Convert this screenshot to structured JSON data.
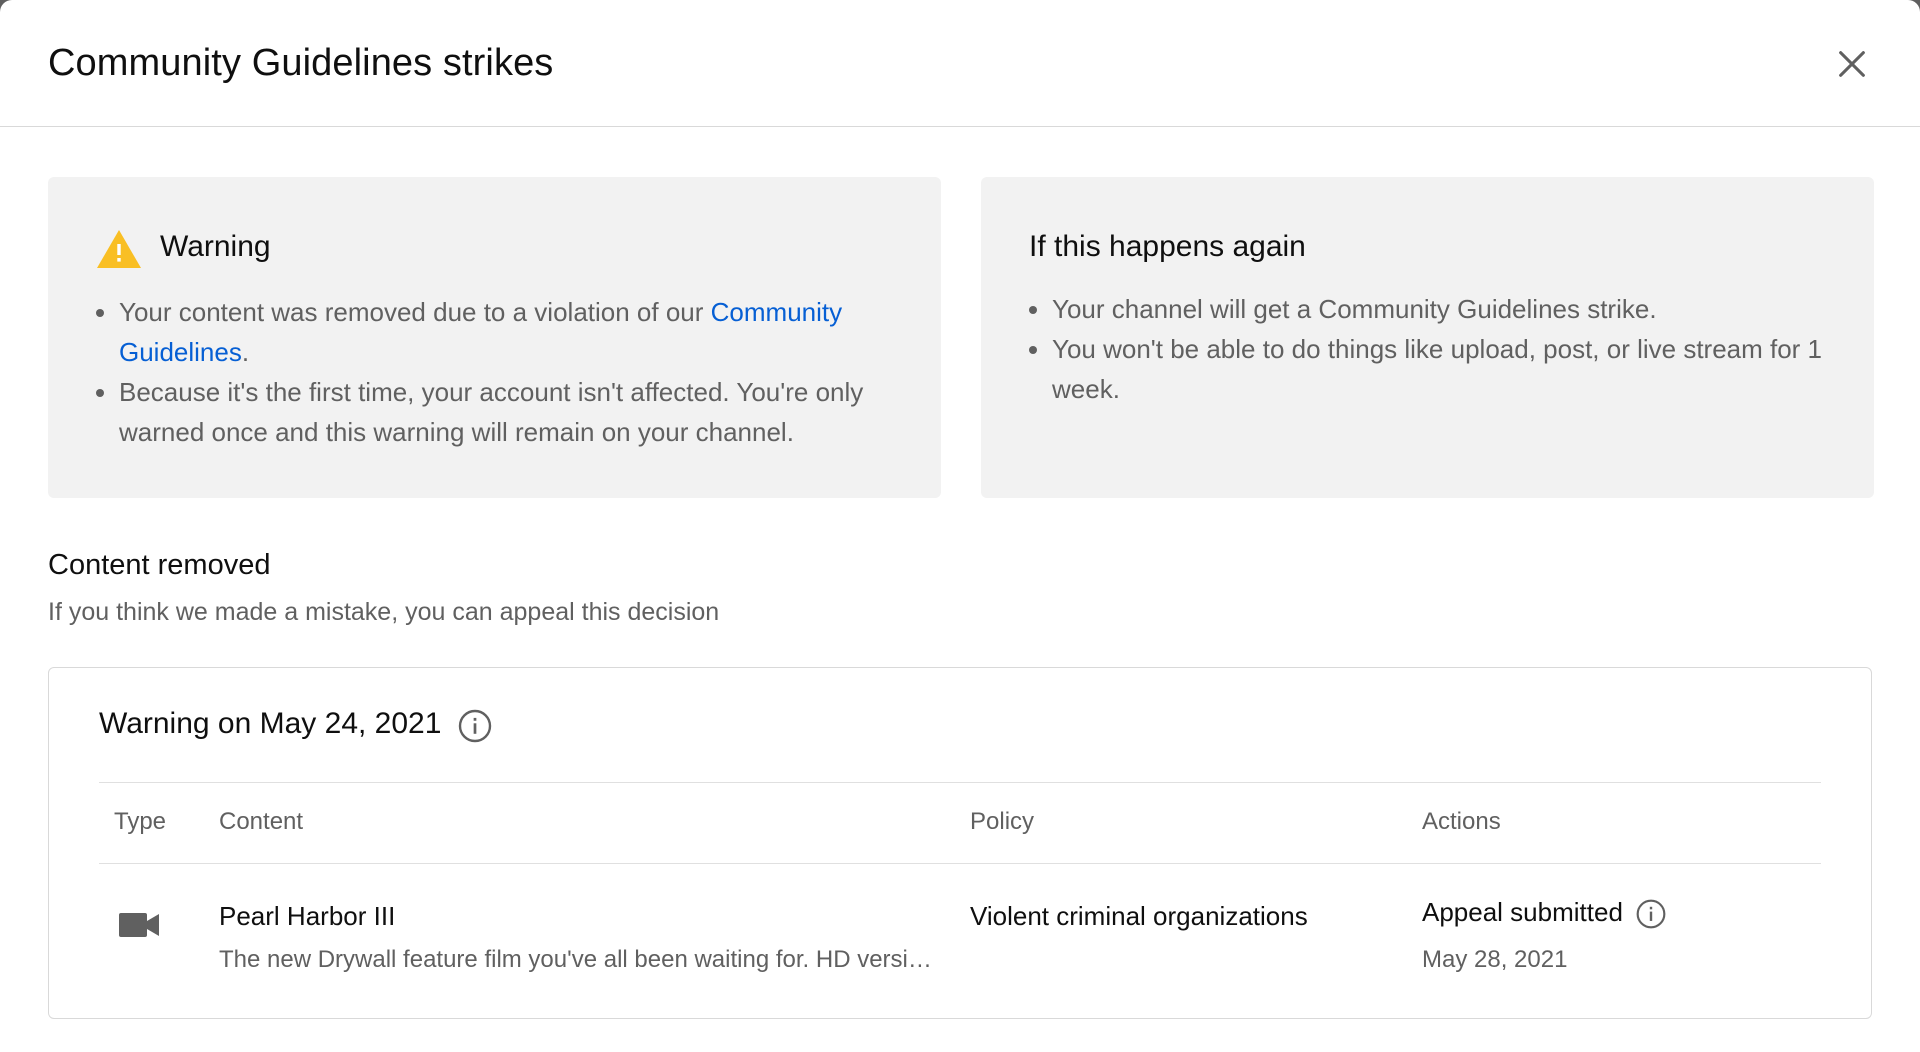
{
  "dialog": {
    "title": "Community Guidelines strikes",
    "close_icon": "close-icon"
  },
  "warning_card": {
    "heading": "Warning",
    "icon": "warning-triangle-icon",
    "icon_color": "#f9bf24",
    "bullet1_prefix": "Your content was removed due to a violation of our",
    "bullet1_link": "Community Guidelines",
    "bullet1_suffix": ".",
    "bullet2": "Because it's the first time, your account isn't affected. You're only warned once and this warning will remain on your channel."
  },
  "again_card": {
    "heading": "If this happens again",
    "bullet1": "Your channel will get a Community Guidelines strike.",
    "bullet2": "You won't be able to do things like upload, post, or live stream for 1 week."
  },
  "content_removed": {
    "title": "Content removed",
    "subtitle": "If you think we made a mistake, you can appeal this decision"
  },
  "warning_table": {
    "title": "Warning on May 24, 2021",
    "title_info_icon": "info-icon",
    "columns": [
      "Type",
      "Content",
      "Policy",
      "Actions"
    ],
    "rows": [
      {
        "type_icon": "video-camera-icon",
        "content_title": "Pearl Harbor III",
        "content_desc": "The new Drywall feature film you've all been waiting for. HD version, complete with extended scenes",
        "policy": "Violent criminal organizations",
        "action_status": "Appeal submitted",
        "action_info_icon": "info-icon",
        "action_date": "May 28, 2021"
      }
    ]
  },
  "colors": {
    "link": "#065fd4",
    "card_bg": "#f2f2f2",
    "secondary_text": "#606060"
  }
}
